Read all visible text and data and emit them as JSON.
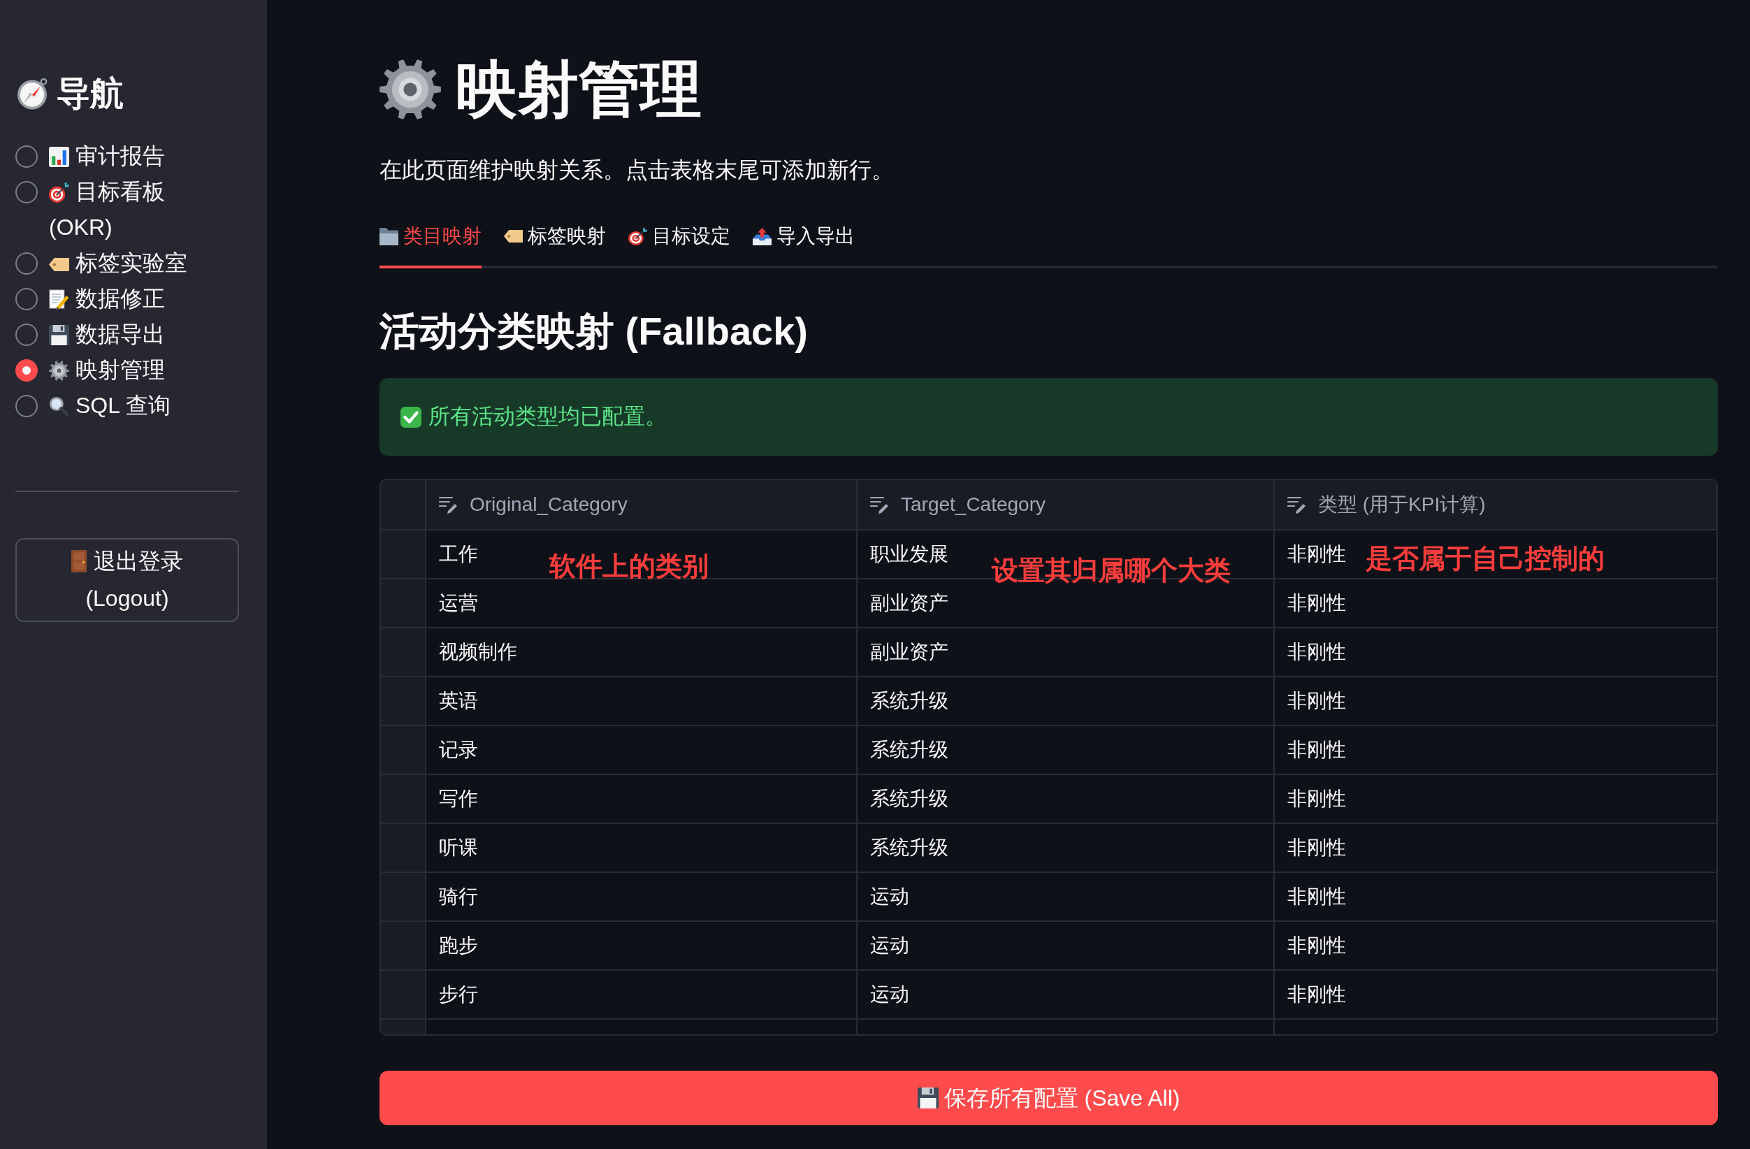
{
  "sidebar": {
    "title": "导航",
    "nav_items": [
      {
        "label": "审计报告",
        "selected": false
      },
      {
        "label": "目标看板 (OKR)",
        "selected": false
      },
      {
        "label": "标签实验室",
        "selected": false
      },
      {
        "label": "数据修正",
        "selected": false
      },
      {
        "label": "数据导出",
        "selected": false
      },
      {
        "label": "映射管理",
        "selected": true
      },
      {
        "label": "SQL 查询",
        "selected": false
      }
    ],
    "logout_button": "退出登录 (Logout)"
  },
  "main": {
    "title": "映射管理",
    "description": "在此页面维护映射关系。点击表格末尾可添加新行。",
    "tabs": [
      {
        "label": "类目映射",
        "selected": true
      },
      {
        "label": "标签映射",
        "selected": false
      },
      {
        "label": "目标设定",
        "selected": false
      },
      {
        "label": "导入导出",
        "selected": false
      }
    ],
    "section_title": "活动分类映射 (Fallback)",
    "success_message": "所有活动类型均已配置。",
    "table": {
      "columns": [
        "Original_Category",
        "Target_Category",
        "类型 (用于KPI计算)"
      ],
      "rows": [
        [
          "工作",
          "职业发展",
          "非刚性"
        ],
        [
          "运营",
          "副业资产",
          "非刚性"
        ],
        [
          "视频制作",
          "副业资产",
          "非刚性"
        ],
        [
          "英语",
          "系统升级",
          "非刚性"
        ],
        [
          "记录",
          "系统升级",
          "非刚性"
        ],
        [
          "写作",
          "系统升级",
          "非刚性"
        ],
        [
          "听课",
          "系统升级",
          "非刚性"
        ],
        [
          "骑行",
          "运动",
          "非刚性"
        ],
        [
          "跑步",
          "运动",
          "非刚性"
        ],
        [
          "步行",
          "运动",
          "非刚性"
        ]
      ]
    },
    "annotations": [
      "软件上的类别",
      "设置其归属哪个大类",
      "是否属于自己控制的"
    ],
    "save_button": "保存所有配置 (Save All)"
  }
}
